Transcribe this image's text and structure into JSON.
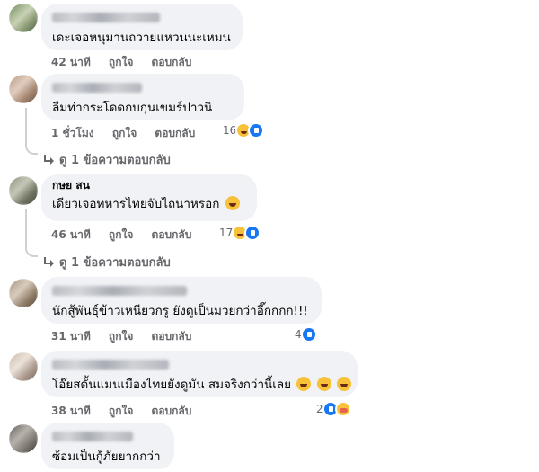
{
  "comments": [
    {
      "text": "เดะเจอหนุมานถวายแหวนนะเหมน",
      "time": "42 นาที",
      "like": "ถูกใจ",
      "reply": "ตอบกลับ",
      "reaction_count": ""
    },
    {
      "text": "ลืมท่ากระโดดกบกุนเขมร์ปาวนิ",
      "time": "1 ชั่วโมง",
      "like": "ถูกใจ",
      "reply": "ตอบกลับ",
      "reaction_count": "16",
      "reactions": [
        "haha-icon",
        "like-icon"
      ],
      "view_replies": "ดู 1 ข้อความตอบกลับ"
    },
    {
      "partial_name": "กษย สน",
      "text": "เดียวเจอทหารไทยจับไถนาหรอก",
      "time": "46 นาที",
      "like": "ถูกใจ",
      "reply": "ตอบกลับ",
      "reaction_count": "17",
      "reactions": [
        "haha-icon",
        "like-icon"
      ],
      "view_replies": "ดู 1 ข้อความตอบกลับ"
    },
    {
      "text": "นักสู้พันธุ์ข้าวเหนียวกรู ยังดูเป็นมวยกว่าอี๊กกกก!!!",
      "time": "31 นาที",
      "like": "ถูกใจ",
      "reply": "ตอบกลับ",
      "reaction_count": "4",
      "reactions": [
        "like-icon"
      ]
    },
    {
      "text": "โอ๊ยสดั้นแมนเมืองไทยยังดูมัน สมจริงกว่านี้เลย",
      "time": "38 นาที",
      "like": "ถูกใจ",
      "reply": "ตอบกลับ",
      "reaction_count": "2",
      "reactions": [
        "like-icon",
        "care-icon"
      ]
    },
    {
      "text": "ซ้อมเป็นกู้ภัยยากกว่า"
    }
  ],
  "colors": {
    "bubble": "#f0f2f5",
    "meta": "#65676b",
    "like_blue": "#1877f2",
    "emoji_yellow": "#f7c23a"
  }
}
